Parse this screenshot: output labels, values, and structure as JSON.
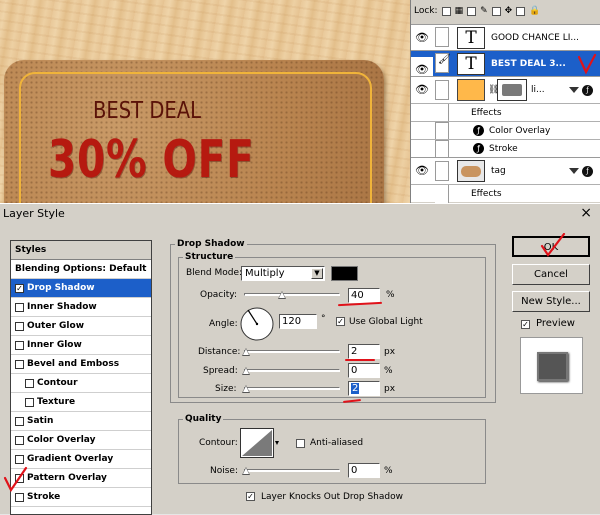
{
  "canvas": {
    "heading": "BEST DEAL",
    "discount": "30% OFF"
  },
  "layers_panel": {
    "lock_label": "Lock:",
    "layers": [
      {
        "name": "GOOD CHANCE LI...",
        "thumb": "T",
        "selected": false
      },
      {
        "name": "BEST DEAL   3...",
        "thumb": "T",
        "selected": true
      },
      {
        "name": "li...",
        "thumb": "shape",
        "selected": false
      },
      {
        "name": "tag",
        "thumb": "image",
        "selected": false
      }
    ],
    "effects_label": "Effects",
    "effects": [
      "Color Overlay",
      "Stroke"
    ],
    "effects_label_2": "Effects"
  },
  "dialog": {
    "title": "Layer Style",
    "close": "×",
    "styles_header": "Styles",
    "styles": [
      {
        "label": "Blending Options: Default",
        "checkbox": false,
        "checked": false,
        "indent": false,
        "active": false
      },
      {
        "label": "Drop Shadow",
        "checkbox": true,
        "checked": true,
        "indent": false,
        "active": true
      },
      {
        "label": "Inner Shadow",
        "checkbox": true,
        "checked": false,
        "indent": false,
        "active": false
      },
      {
        "label": "Outer Glow",
        "checkbox": true,
        "checked": false,
        "indent": false,
        "active": false
      },
      {
        "label": "Inner Glow",
        "checkbox": true,
        "checked": false,
        "indent": false,
        "active": false
      },
      {
        "label": "Bevel and Emboss",
        "checkbox": true,
        "checked": false,
        "indent": false,
        "active": false
      },
      {
        "label": "Contour",
        "checkbox": true,
        "checked": false,
        "indent": true,
        "active": false
      },
      {
        "label": "Texture",
        "checkbox": true,
        "checked": false,
        "indent": true,
        "active": false
      },
      {
        "label": "Satin",
        "checkbox": true,
        "checked": false,
        "indent": false,
        "active": false
      },
      {
        "label": "Color Overlay",
        "checkbox": true,
        "checked": false,
        "indent": false,
        "active": false
      },
      {
        "label": "Gradient Overlay",
        "checkbox": true,
        "checked": false,
        "indent": false,
        "active": false
      },
      {
        "label": "Pattern Overlay",
        "checkbox": true,
        "checked": false,
        "indent": false,
        "active": false
      },
      {
        "label": "Stroke",
        "checkbox": true,
        "checked": false,
        "indent": false,
        "active": false
      }
    ],
    "drop_shadow": {
      "section_title": "Drop Shadow",
      "structure_title": "Structure",
      "blend_mode_label": "Blend Mode:",
      "blend_mode_value": "Multiply",
      "shadow_color": "#000000",
      "opacity_label": "Opacity:",
      "opacity_value": "40",
      "opacity_unit": "%",
      "angle_label": "Angle:",
      "angle_value": "120",
      "angle_unit": "°",
      "global_light_label": "Use Global Light",
      "global_light_checked": true,
      "distance_label": "Distance:",
      "distance_value": "2",
      "distance_unit": "px",
      "spread_label": "Spread:",
      "spread_value": "0",
      "spread_unit": "%",
      "size_label": "Size:",
      "size_value": "2",
      "size_unit": "px",
      "quality_title": "Quality",
      "contour_label": "Contour:",
      "anti_aliased_label": "Anti-aliased",
      "noise_label": "Noise:",
      "noise_value": "0",
      "noise_unit": "%",
      "knockout_label": "Layer Knocks Out Drop Shadow",
      "knockout_checked": true
    },
    "buttons": {
      "ok": "OK",
      "cancel": "Cancel",
      "new_style": "New Style...",
      "preview_label": "Preview",
      "preview_checked": true
    }
  }
}
